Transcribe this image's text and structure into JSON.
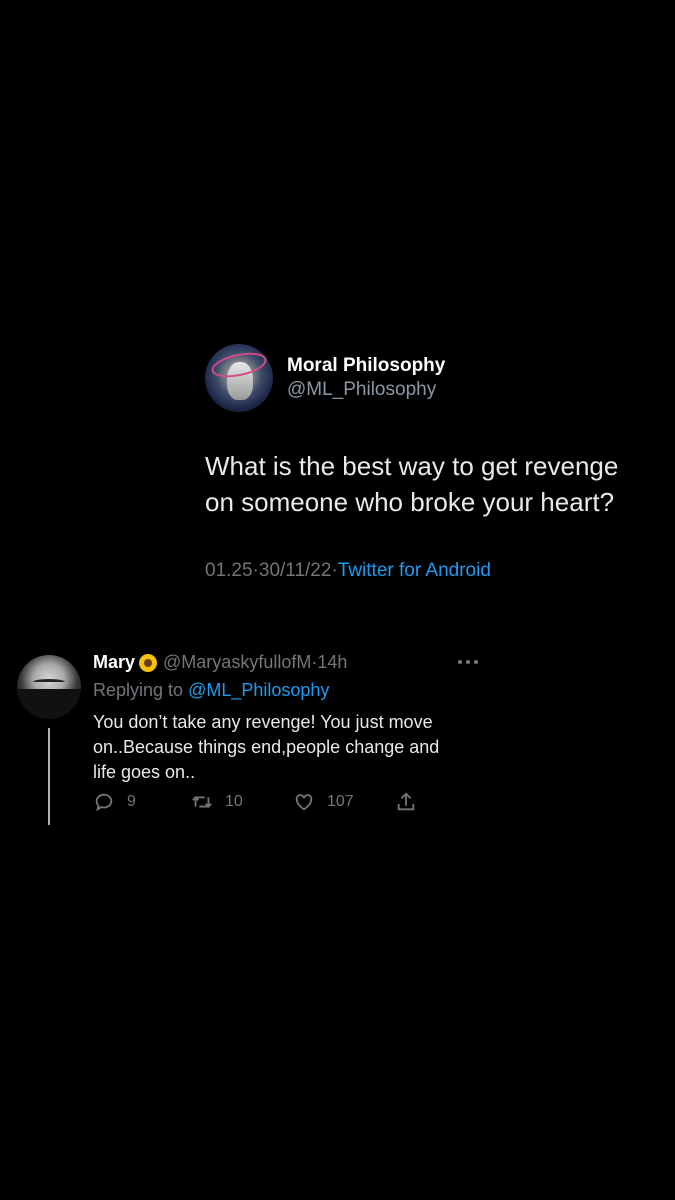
{
  "tweet": {
    "display_name": "Moral Philosophy",
    "handle": "@ML_Philosophy",
    "text": "What is the best way to get revenge\non someone who broke your heart?",
    "time": "01.25",
    "date": "30/11/22",
    "source": "Twitter for Android",
    "separator": " · "
  },
  "reply": {
    "display_name": "Mary",
    "emoji_icon": "sunflower-icon",
    "handle": "@MaryaskyfullofM",
    "age": "14h",
    "separator": " · ",
    "replying_prefix": "Replying to ",
    "replying_to": "@ML_Philosophy",
    "text": "You don’t take any revenge! You just move\non..Because things end,people change and\nlife goes on..",
    "counts": {
      "replies": "9",
      "retweets": "10",
      "likes": "107"
    }
  },
  "colors": {
    "background": "#000000",
    "link": "#1d9bf0",
    "muted": "#71767b",
    "text": "#e7e9ea"
  }
}
